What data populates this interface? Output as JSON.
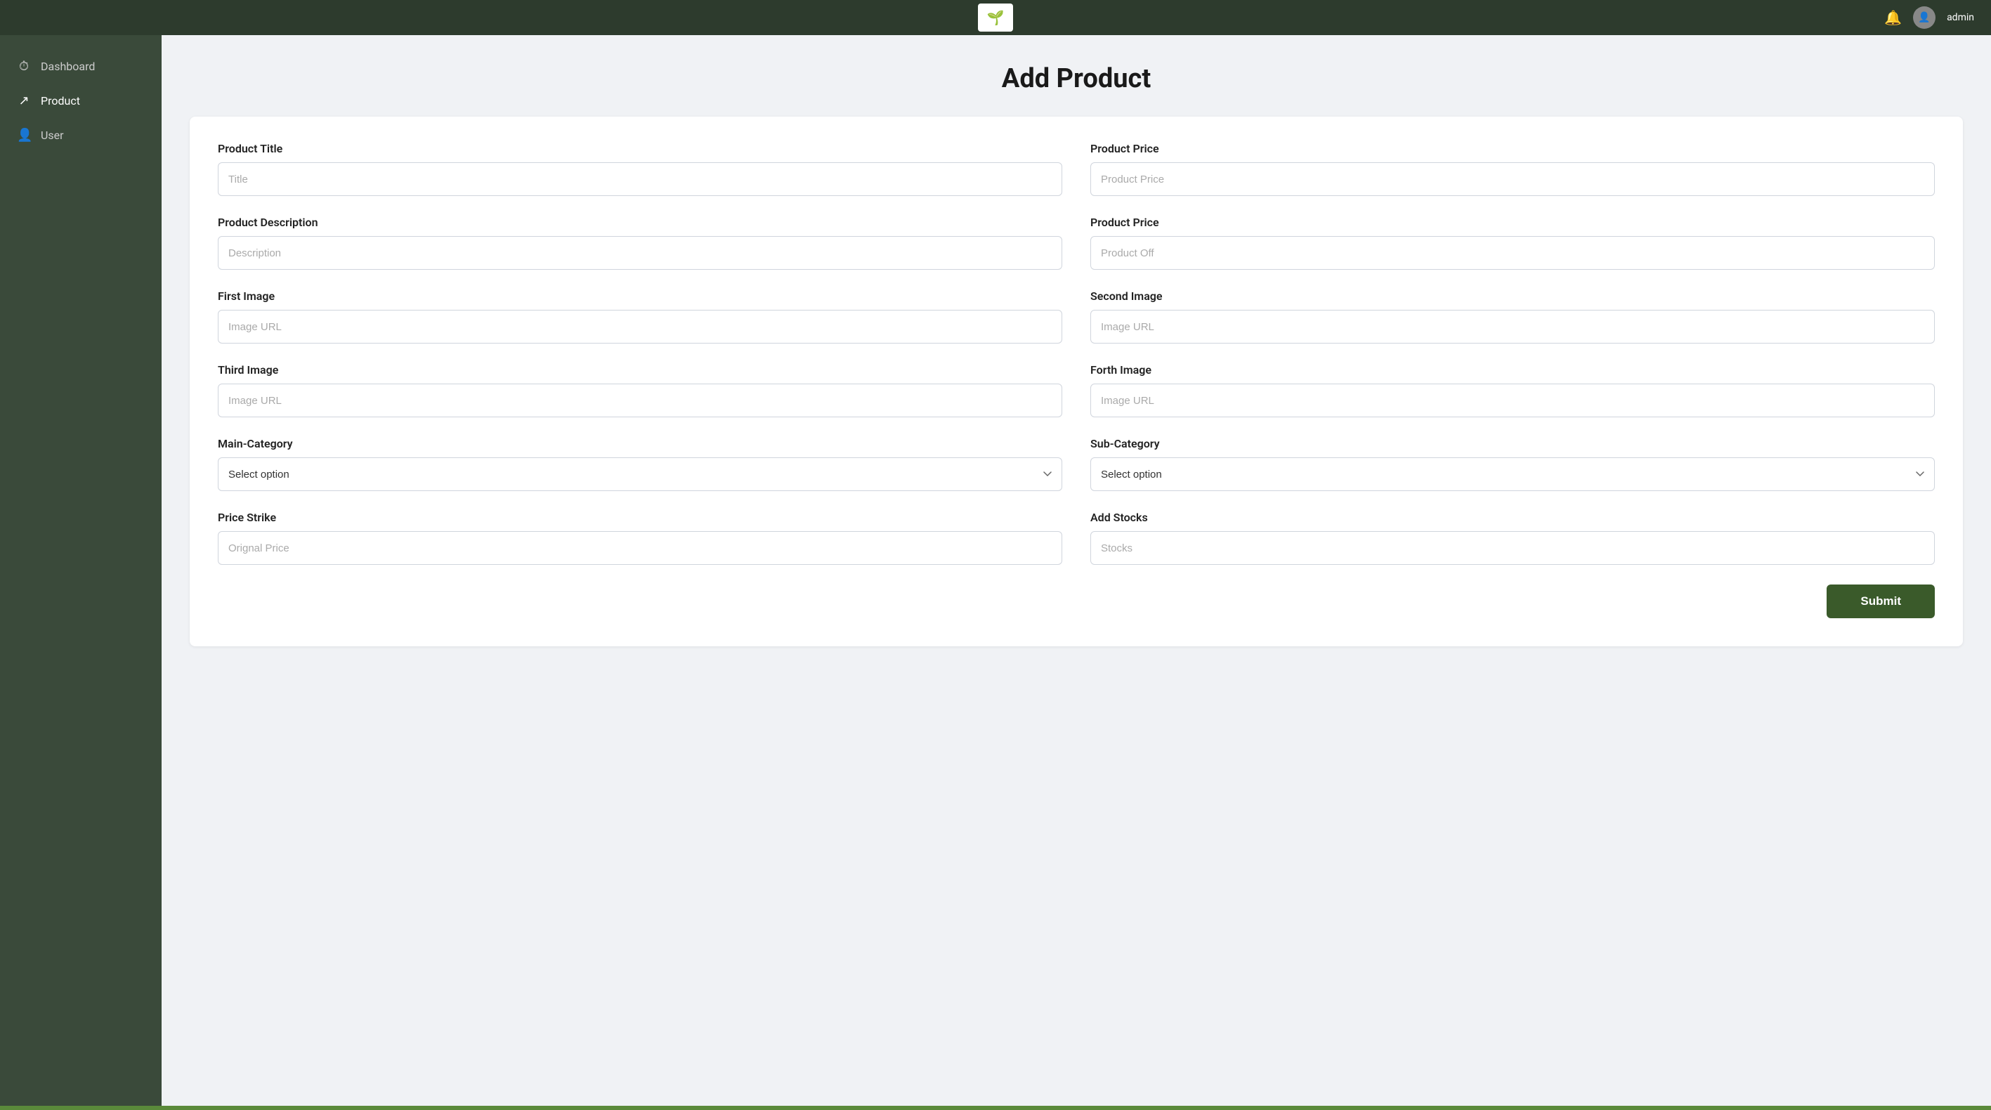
{
  "navbar": {
    "logo_icon": "🌱",
    "username": "admin",
    "bell_icon": "🔔",
    "avatar_icon": "👤"
  },
  "sidebar": {
    "items": [
      {
        "id": "dashboard",
        "label": "Dashboard",
        "icon": "⏱"
      },
      {
        "id": "product",
        "label": "Product",
        "icon": "↗"
      },
      {
        "id": "user",
        "label": "User",
        "icon": "👤"
      }
    ]
  },
  "page": {
    "title": "Add Product"
  },
  "form": {
    "rows": [
      {
        "left": {
          "label": "Product Title",
          "type": "input",
          "placeholder": "Title",
          "name": "product-title-input"
        },
        "right": {
          "label": "Product Price",
          "type": "input",
          "placeholder": "Product Price",
          "name": "product-price-input"
        }
      },
      {
        "left": {
          "label": "Product Description",
          "type": "input",
          "placeholder": "Description",
          "name": "product-description-input"
        },
        "right": {
          "label": "Product Price",
          "type": "input",
          "placeholder": "Product Off",
          "name": "product-off-input"
        }
      },
      {
        "left": {
          "label": "First Image",
          "type": "input",
          "placeholder": "Image URL",
          "name": "first-image-input"
        },
        "right": {
          "label": "Second Image",
          "type": "input",
          "placeholder": "Image URL",
          "name": "second-image-input"
        }
      },
      {
        "left": {
          "label": "Third Image",
          "type": "input",
          "placeholder": "Image URL",
          "name": "third-image-input"
        },
        "right": {
          "label": "Forth Image",
          "type": "input",
          "placeholder": "Image URL",
          "name": "forth-image-input"
        }
      },
      {
        "left": {
          "label": "Main-Category",
          "type": "select",
          "placeholder": "Select option",
          "name": "main-category-select"
        },
        "right": {
          "label": "Sub-Category",
          "type": "select",
          "placeholder": "Select option",
          "name": "sub-category-select"
        }
      },
      {
        "left": {
          "label": "Price Strike",
          "type": "input",
          "placeholder": "Orignal Price",
          "name": "price-strike-input"
        },
        "right": {
          "label": "Add Stocks",
          "type": "input",
          "placeholder": "Stocks",
          "name": "add-stocks-input"
        }
      }
    ],
    "submit_label": "Submit"
  }
}
